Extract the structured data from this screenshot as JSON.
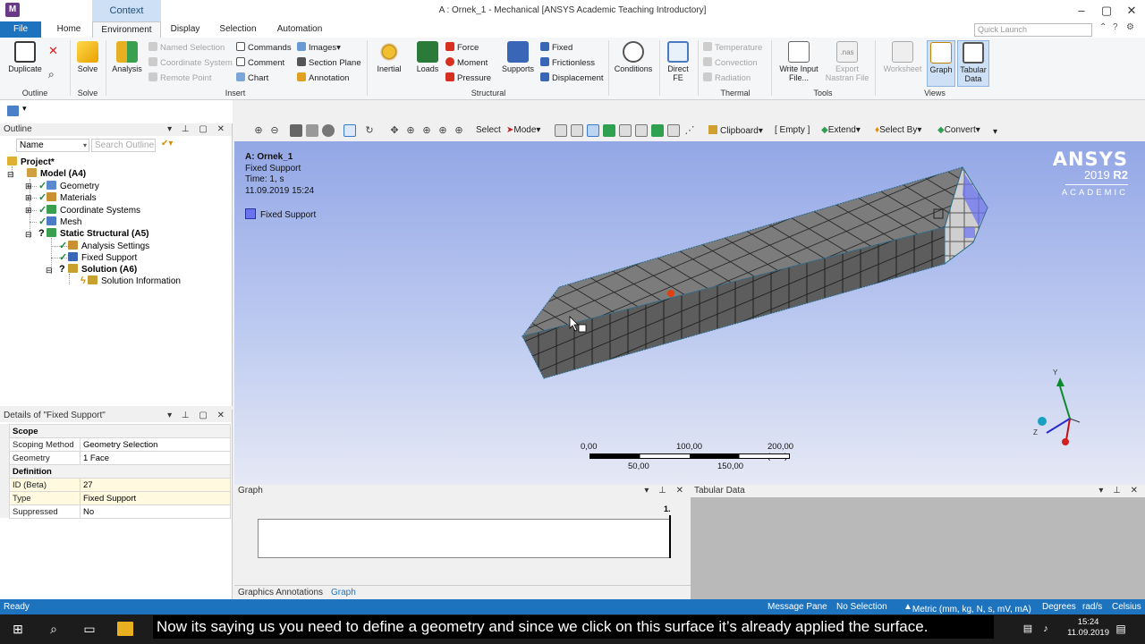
{
  "window": {
    "title": "A : Ornek_1 - Mechanical [ANSYS Academic Teaching Introductory]",
    "context_tab": "Context",
    "app_icon": "M",
    "controls": [
      "–",
      "▢",
      "✕"
    ]
  },
  "tabs": {
    "file": "File",
    "items": [
      "Home",
      "Environment",
      "Display",
      "Selection",
      "Automation"
    ],
    "active": "Environment",
    "quick_launch": "Quick Launch"
  },
  "ribbon": {
    "outline_group": {
      "label": "Outline",
      "duplicate": "Duplicate"
    },
    "solve_group": {
      "label": "Solve",
      "solve": "Solve"
    },
    "insert_group": {
      "label": "Insert",
      "analysis": "Analysis",
      "named_selection": "Named Selection",
      "coordinate_system": "Coordinate System",
      "remote_point": "Remote Point",
      "commands": "Commands",
      "comment": "Comment",
      "chart": "Chart",
      "images": "Images",
      "section_plane": "Section Plane",
      "annotation": "Annotation"
    },
    "structural_group": {
      "label": "Structural",
      "inertial": "Inertial",
      "loads": "Loads",
      "force": "Force",
      "moment": "Moment",
      "pressure": "Pressure",
      "supports": "Supports",
      "fixed": "Fixed",
      "frictionless": "Frictionless",
      "displacement": "Displacement"
    },
    "conditions": "Conditions",
    "direct_fe": "Direct FE",
    "thermal_group": {
      "label": "Thermal",
      "temperature": "Temperature",
      "convection": "Convection",
      "radiation": "Radiation"
    },
    "tools_group": {
      "label": "Tools",
      "write_input": "Write Input File...",
      "export_nastran": "Export Nastran File",
      "nas_tag": ".nas"
    },
    "views_group": {
      "label": "Views",
      "worksheet": "Worksheet",
      "graph": "Graph",
      "tabular": "Tabular Data"
    }
  },
  "toolbar": {
    "select": "Select",
    "mode": "Mode",
    "clipboard": "Clipboard",
    "empty": "[ Empty ]",
    "extend": "Extend",
    "select_by": "Select By",
    "convert": "Convert"
  },
  "outline": {
    "title": "Outline",
    "filter": "Name",
    "search_placeholder": "Search Outline",
    "tree": {
      "project": "Project*",
      "model": "Model (A4)",
      "geometry": "Geometry",
      "materials": "Materials",
      "coordinate_systems": "Coordinate Systems",
      "mesh": "Mesh",
      "static_structural": "Static Structural (A5)",
      "analysis_settings": "Analysis Settings",
      "fixed_support": "Fixed Support",
      "solution": "Solution (A6)",
      "solution_information": "Solution Information"
    }
  },
  "details": {
    "title": "Details of \"Fixed Support\"",
    "rows": [
      {
        "k": "Scope",
        "v": ""
      },
      {
        "k": "Scoping Method",
        "v": "Geometry Selection"
      },
      {
        "k": "Geometry",
        "v": "1 Face"
      },
      {
        "k": "Definition",
        "v": ""
      },
      {
        "k": "ID (Beta)",
        "v": "27"
      },
      {
        "k": "Type",
        "v": "Fixed Support"
      },
      {
        "k": "Suppressed",
        "v": "No"
      }
    ]
  },
  "viewport": {
    "info": [
      "A: Ornek_1",
      "Fixed Support",
      "Time: 1, s",
      "11.09.2019 15:24"
    ],
    "legend": "Fixed Support",
    "brand": {
      "name": "ANSYS",
      "year": "2019",
      "release": "R2",
      "edition": "ACADEMIC"
    },
    "scale": {
      "top": [
        "0,00",
        "100,00",
        "200,00 (mm)"
      ],
      "bottom": [
        "50,00",
        "150,00"
      ]
    },
    "axes": {
      "y": "Y",
      "z": "Z",
      "x": "X"
    }
  },
  "graph": {
    "title": "Graph",
    "marker": "1.",
    "tabs": [
      "Graphics Annotations",
      "Graph"
    ]
  },
  "tabular": {
    "title": "Tabular Data"
  },
  "status": {
    "ready": "Ready",
    "message_pane": "Message Pane",
    "selection": "No Selection",
    "units": "Metric (mm, kg, N, s, mV, mA)",
    "degrees": "Degrees",
    "rads": "rad/s",
    "temp": "Celsius"
  },
  "taskbar": {
    "caption": "Now its saying us you need to define a geometry and since we click on this surface it’s already applied the surface.",
    "time": "15:24",
    "date": "11.09.2019"
  }
}
